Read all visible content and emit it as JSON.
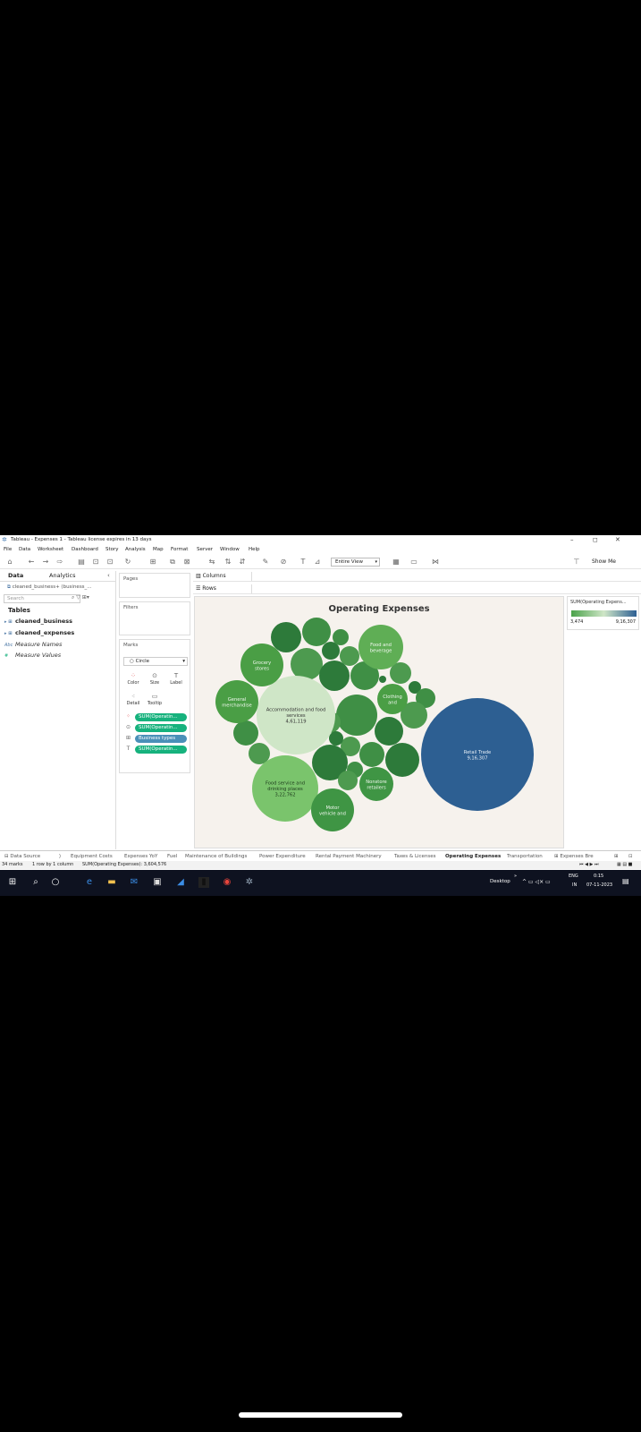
{
  "window": {
    "title": "Tableau - Expenses 1 - Tableau license expires in 13 days",
    "controls": [
      "–",
      "◻",
      "✕"
    ]
  },
  "menu": [
    "File",
    "Data",
    "Worksheet",
    "Dashboard",
    "Story",
    "Analysis",
    "Map",
    "Format",
    "Server",
    "Window",
    "Help"
  ],
  "toolbar": {
    "view": "Entire View",
    "show_me": "Show Me"
  },
  "data_pane": {
    "tab_data": "Data",
    "tab_analytics": "Analytics",
    "datasource": "cleaned_business+ (business_...",
    "search_placeholder": "Search",
    "tables_heading": "Tables",
    "fields": [
      {
        "icon": "▸ ⊞",
        "label": "cleaned_business"
      },
      {
        "icon": "▸ ⊞",
        "label": "cleaned_expenses"
      },
      {
        "icon": "Abc",
        "label": "Measure Names"
      },
      {
        "icon": "#",
        "label": "Measure Values"
      }
    ]
  },
  "cards": {
    "pages": "Pages",
    "filters": "Filters",
    "marks": "Marks",
    "mark_type": "Circle",
    "buttons": [
      "Color",
      "Size",
      "Label",
      "Detail",
      "Tooltip"
    ],
    "pills": [
      {
        "label": "SUM(Operatin...",
        "kind": "color"
      },
      {
        "label": "SUM(Operatin...",
        "kind": "size"
      },
      {
        "label": "Business types",
        "kind": "detail"
      },
      {
        "label": "SUM(Operatin...",
        "kind": "label"
      }
    ]
  },
  "shelves": {
    "columns": "Columns",
    "rows": "Rows"
  },
  "legend": {
    "title": "SUM(Operating Expens...",
    "min": "3,474",
    "max": "9,16,307"
  },
  "chart_data": {
    "type": "packed-bubble",
    "title": "Operating Expenses",
    "measure": "SUM(Operating Expenses)",
    "color_scale": {
      "low": "#4aa24a",
      "mid": "#cfe6c7",
      "high": "#2d5f92"
    },
    "labeled_bubbles": [
      {
        "label": "Retail Trade",
        "value": "9,16,307"
      },
      {
        "label": "Accommodation and food services",
        "value": "4,61,119"
      },
      {
        "label": "Food service and drinking places",
        "value": "3,22,762"
      },
      {
        "label": "Food and beverage",
        "value": ""
      },
      {
        "label": "Grocery stores",
        "value": ""
      },
      {
        "label": "General merchandise",
        "value": ""
      },
      {
        "label": "Clothing and",
        "value": ""
      },
      {
        "label": "Nonstore retailers",
        "value": ""
      },
      {
        "label": "Motor vehicle and",
        "value": ""
      }
    ],
    "total_marks": 34
  },
  "sheet_tabs": [
    "Data Source",
    "Equipment Costs",
    "Expenses YoY",
    "Fuel",
    "Maintenance of Buildings",
    "Power Expenditure",
    "Rental Payment Machinery",
    "Taxes & Licenses",
    "Operating Expenses",
    "Transportation",
    "Expenses Bre"
  ],
  "active_sheet": "Operating Expenses",
  "status": {
    "marks": "34 marks",
    "layout": "1 row by 1 column",
    "sum": "SUM(Operating Expenses): 3,604,576"
  },
  "taskbar": {
    "desktop": "Desktop",
    "lang1": "ENG",
    "lang2": "IN",
    "time": "0:15",
    "date": "07-11-2023"
  }
}
